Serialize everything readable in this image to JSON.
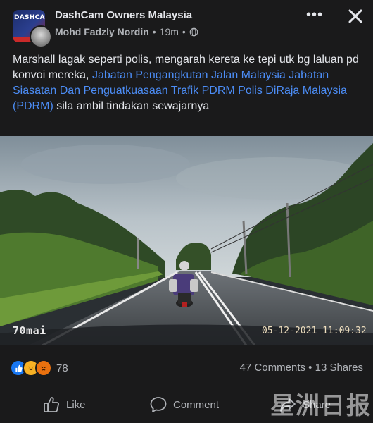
{
  "post": {
    "group_name": "DashCam Owners Malaysia",
    "author": "Mohd Fadzly Nordin",
    "time": "19m",
    "separator": "•",
    "text_plain_1": "Marshall lagak seperti polis, mengarah kereta ke tepi utk bg laluan pd konvoi mereka, ",
    "text_link": "Jabatan Pengangkutan Jalan Malaysia Jabatan Siasatan Dan Penguatkuasaan Trafik PDRM Polis DiRaja Malaysia (PDRM)",
    "text_plain_2": " sila ambil tindakan sewajarnya"
  },
  "media": {
    "camera_logo": "70mai",
    "timestamp": "05-12-2021 11:09:32"
  },
  "engagement": {
    "reaction_count": "78",
    "comments": "47 Comments",
    "separator": "•",
    "shares": "13 Shares"
  },
  "actions": {
    "like": "Like",
    "comment": "Comment",
    "share": "Share"
  },
  "watermark": "星洲日报",
  "icons": {
    "more": "more-options-icon",
    "close": "close-icon",
    "globe": "globe-icon",
    "like": "thumbs-up-icon",
    "comment": "comment-bubble-icon",
    "share": "share-arrow-icon"
  },
  "colors": {
    "background": "#1a1a1b",
    "link": "#4c8df6",
    "text": "#e4e6eb",
    "muted": "#b0b3b8",
    "like_reaction": "#1877f2"
  }
}
